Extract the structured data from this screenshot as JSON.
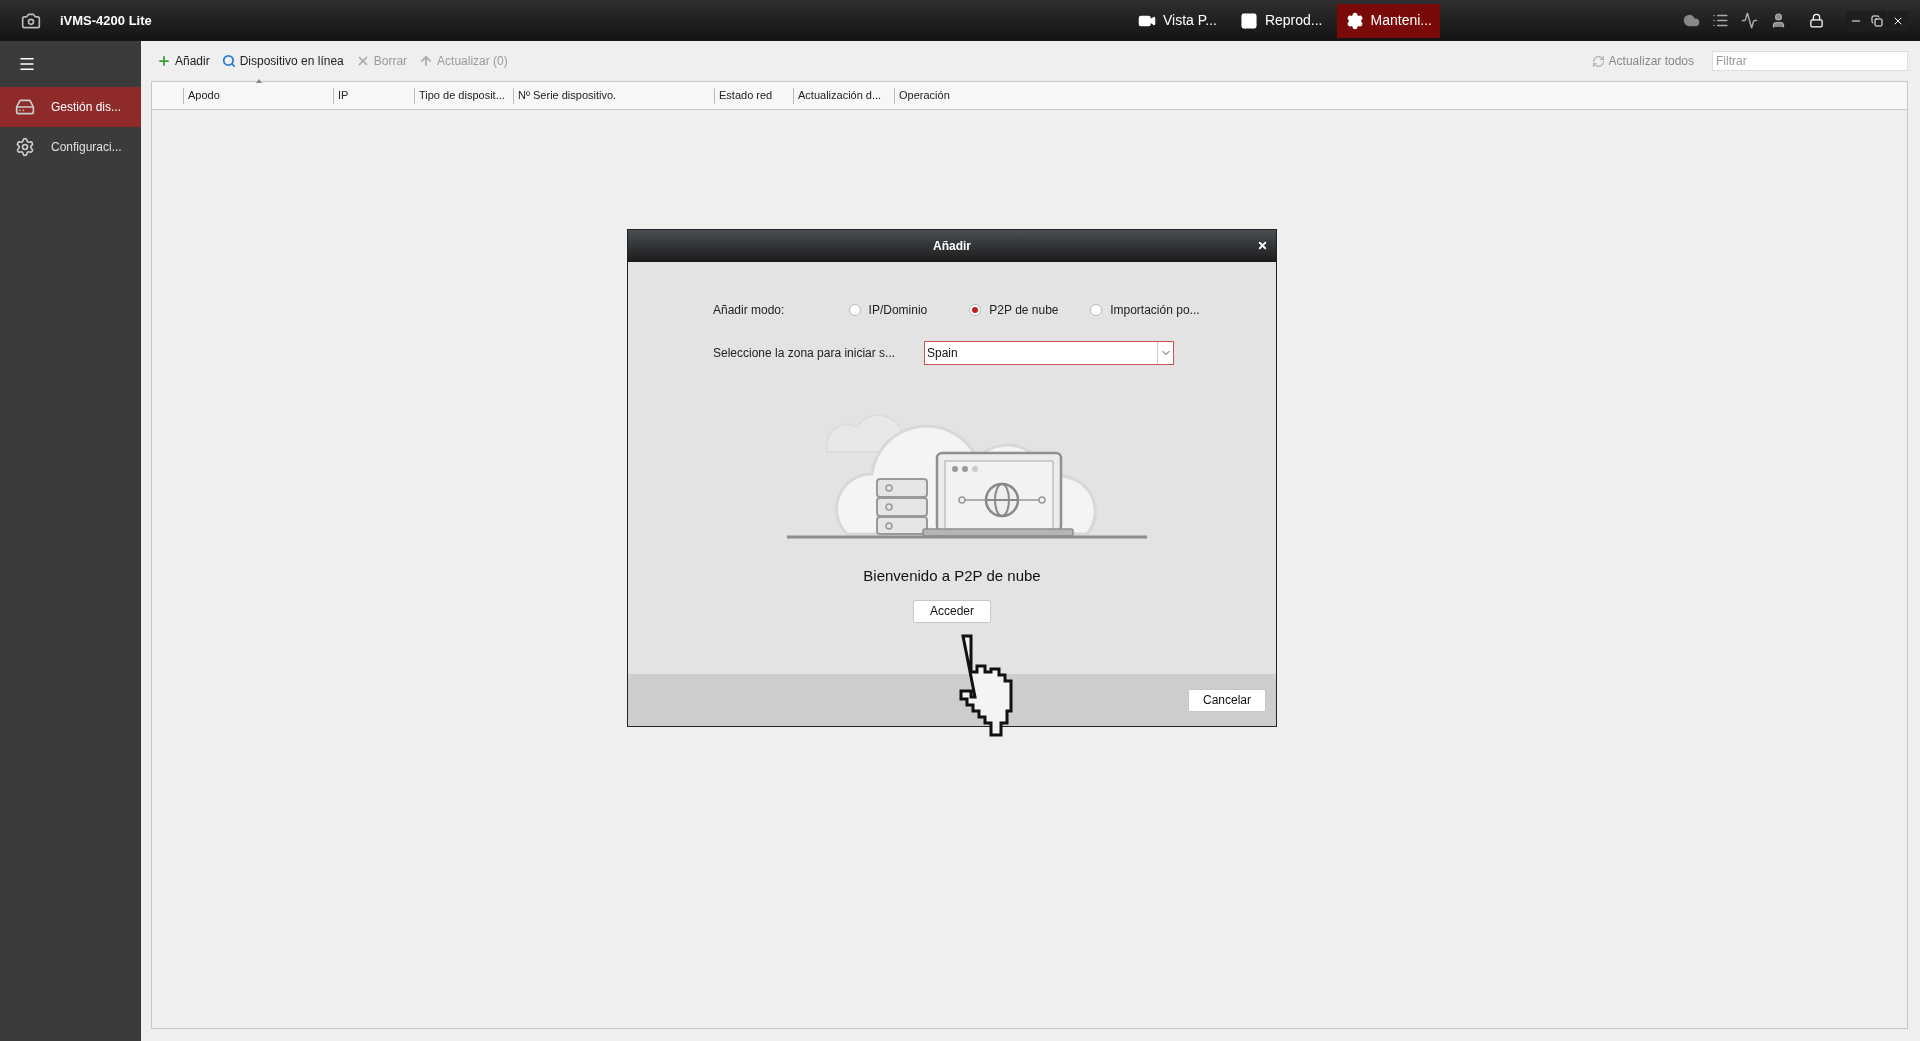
{
  "window": {
    "title": "iVMS-4200 Lite"
  },
  "top_tabs": [
    {
      "label": "Vista P...",
      "selected": false
    },
    {
      "label": "Reprod...",
      "selected": false
    },
    {
      "label": "Manteni...",
      "selected": true
    }
  ],
  "sidebar": {
    "items": [
      {
        "label": "Gestión dis...",
        "selected": true
      },
      {
        "label": "Configuraci...",
        "selected": false
      }
    ]
  },
  "toolbar": {
    "actions": [
      {
        "label": "Añadir",
        "disabled": false
      },
      {
        "label": "Dispositivo en línea",
        "disabled": false
      },
      {
        "label": "Borrar",
        "disabled": true
      },
      {
        "label": "Actualizar (0)",
        "disabled": true
      }
    ],
    "refresh_all": "Actualizar todos",
    "filter": {
      "placeholder": "Filtrar"
    }
  },
  "table": {
    "columns": [
      "Apodo",
      "IP",
      "Tipo de disposit...",
      "Nº Serie dispositivo.",
      "Estado red",
      "Actualización d...",
      "Operación"
    ]
  },
  "dialog": {
    "title": "Añadir",
    "mode_label": "Añadir modo:",
    "modes": [
      {
        "label": "IP/Dominio",
        "selected": false
      },
      {
        "label": "P2P de nube",
        "selected": true
      },
      {
        "label": "Importación po...",
        "selected": false
      }
    ],
    "zone_label": "Seleccione la zona para iniciar s...",
    "zone_value": "Spain",
    "welcome": "Bienvenido a P2P de nube",
    "access_button": "Acceder",
    "cancel_button": "Cancelar"
  }
}
